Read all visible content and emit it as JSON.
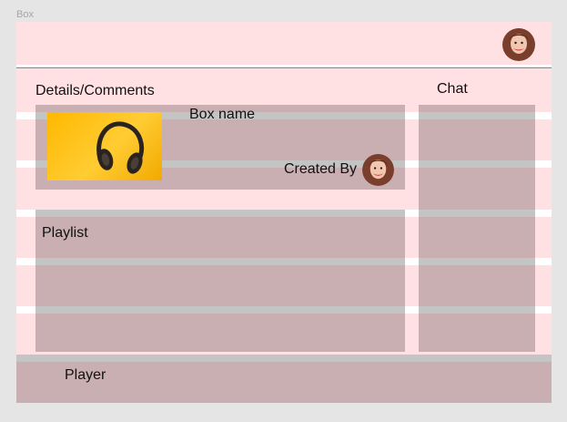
{
  "frame": {
    "title": "Box"
  },
  "header": {
    "avatar": "user-avatar"
  },
  "details": {
    "heading": "Details/Comments",
    "box_name": "Box name",
    "created_by": "Created By"
  },
  "chat": {
    "heading": "Chat"
  },
  "playlist": {
    "heading": "Playlist"
  },
  "player": {
    "heading": "Player"
  },
  "colors": {
    "background": "#e5e5e5",
    "frame": "#ffe1e3",
    "panel": "#c9afb1",
    "band": "#c4c4c4",
    "thumbnail": "#ffc21a"
  }
}
